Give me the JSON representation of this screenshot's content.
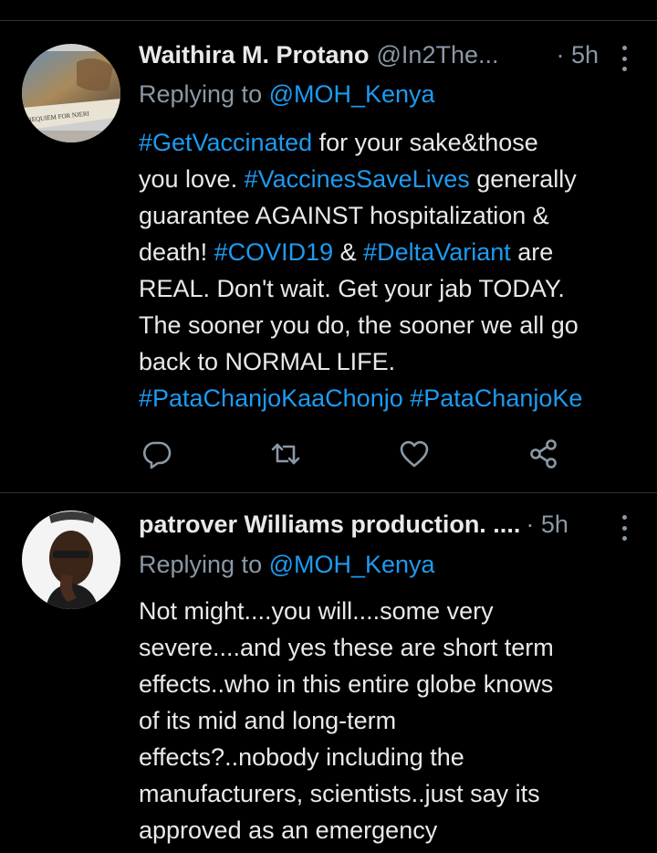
{
  "tweets": [
    {
      "display_name": "Waithira M. Protano",
      "handle": "@In2The...",
      "time": "· 5h",
      "replying_prefix": "Replying to ",
      "replying_to": "@MOH_Kenya",
      "avatar_caption": "REQUIEM FOR NJERI",
      "body_lines": [
        [
          {
            "t": "#GetVaccinated",
            "tag": true
          },
          {
            "t": " for your sake&those",
            "tag": false
          }
        ],
        [
          {
            "t": "you love. ",
            "tag": false
          },
          {
            "t": "#VaccinesSaveLives",
            "tag": true
          },
          {
            "t": " generally",
            "tag": false
          }
        ],
        [
          {
            "t": "guarantee AGAINST hospitalization &",
            "tag": false
          }
        ],
        [
          {
            "t": "death! ",
            "tag": false
          },
          {
            "t": "#COVID19",
            "tag": true
          },
          {
            "t": " & ",
            "tag": false
          },
          {
            "t": "#DeltaVariant",
            "tag": true
          },
          {
            "t": " are",
            "tag": false
          }
        ],
        [
          {
            "t": "REAL. Don't wait. Get your jab TODAY.",
            "tag": false
          }
        ],
        [
          {
            "t": "The sooner you do, the sooner we all go",
            "tag": false
          }
        ],
        [
          {
            "t": "back to NORMAL LIFE.",
            "tag": false
          }
        ],
        [
          {
            "t": "#PataChanjoKaaChonjo",
            "tag": true
          },
          {
            "t": " ",
            "tag": false
          },
          {
            "t": "#PataChanjoKe",
            "tag": true
          }
        ]
      ],
      "actions": [
        "reply-icon",
        "retweet-icon",
        "like-icon",
        "share-icon"
      ]
    },
    {
      "display_name": "patrover Williams production. ....",
      "handle": "",
      "time": "· 5h",
      "replying_prefix": "Replying to ",
      "replying_to": "@MOH_Kenya",
      "body_lines": [
        [
          {
            "t": "Not might....you will....some very",
            "tag": false
          }
        ],
        [
          {
            "t": "severe....and yes these are short term",
            "tag": false
          }
        ],
        [
          {
            "t": "effects..who in this entire globe knows",
            "tag": false
          }
        ],
        [
          {
            "t": "of its mid and long-term",
            "tag": false
          }
        ],
        [
          {
            "t": "effects?..nobody including the",
            "tag": false
          }
        ],
        [
          {
            "t": "manufacturers, scientists..just say its",
            "tag": false
          }
        ],
        [
          {
            "t": "approved as an emergency",
            "tag": false
          }
        ]
      ]
    }
  ],
  "colors": {
    "background": "#000000",
    "text": "#e7e9ea",
    "secondary": "#8b98a5",
    "accent": "#1d9bf0",
    "divider": "#2f3336"
  }
}
